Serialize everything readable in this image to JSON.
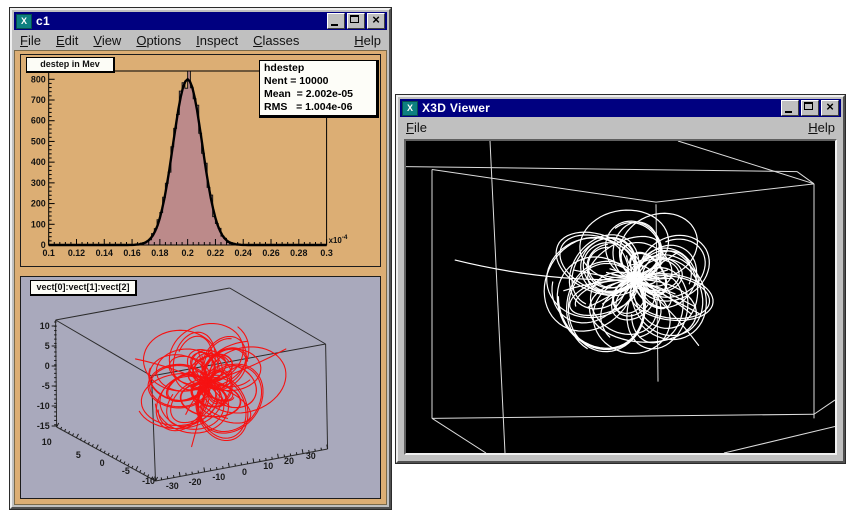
{
  "colors": {
    "titlebar_blue": "#000080",
    "window_gray": "#c0c0c0",
    "canvas_tan": "#dcae74",
    "hist_fill": "#bc8a8a",
    "hist_outline": "#151515",
    "fit_line": "#000000",
    "pad2_lavender": "#a9a9bc",
    "box_line_dark": "#2b2b2b",
    "track_red": "#f61212",
    "x3d_bg": "#000000",
    "x3d_box_line": "#dcdcdc",
    "x3d_track": "#ffffff",
    "icon_teal": "#0d8080"
  },
  "root_window": {
    "title": "c1",
    "icon_glyph": "X",
    "menus": [
      "File",
      "Edit",
      "View",
      "Options",
      "Inspect",
      "Classes"
    ],
    "help_menu": "Help",
    "pad1_title": "destep in Mev",
    "stats_lines": [
      "hdestep",
      "Nent = 10000",
      "Mean  = 2.002e-05",
      "RMS   = 1.004e-06"
    ],
    "pad2_title": "vect[0]:vect[1]:vect[2]"
  },
  "x3d_window": {
    "title": "X3D Viewer",
    "icon_glyph": "X",
    "menus": [
      "File"
    ],
    "help_menu": "Help"
  },
  "chart_data": [
    {
      "type": "histogram",
      "title": "destep in Mev",
      "histogram_name": "hdestep",
      "entries": 10000,
      "mean": "2.002e-05",
      "rms": "1.004e-06",
      "distribution": "gaussian",
      "x_axis_exponent_base": "x10",
      "x_axis_exponent_sup": "-4",
      "x_range": [
        0.1,
        0.3
      ],
      "y_range": [
        0,
        840
      ],
      "bins": 100,
      "gaussian": {
        "mean": 0.2,
        "sigma": 0.0105,
        "amplitude": 805,
        "fit_amplitude": 800
      },
      "x_tick_labels": [
        "0.1",
        "0.12",
        "0.14",
        "0.16",
        "0.18",
        "0.2",
        "0.22",
        "0.24",
        "0.26",
        "0.28",
        "0.3"
      ],
      "y_tick_labels": [
        "0",
        "100",
        "200",
        "300",
        "400",
        "500",
        "600",
        "700",
        "800"
      ],
      "grid": false,
      "legend": false
    },
    {
      "type": "scatter3d",
      "title": "vect[0]:vect[1]:vect[2]",
      "description": "red helical particle-track curves radiating from a central vertex inside a black wireframe 3D box on lavender pad",
      "x_tick_labels": [
        "10",
        "5",
        "0",
        "-5",
        "-10"
      ],
      "y_tick_labels": [
        "-30",
        "-20",
        "-10",
        "0",
        "10",
        "20",
        "30"
      ],
      "z_tick_labels": [
        "10",
        "5",
        "0",
        "-5",
        "-10",
        "-15"
      ],
      "x_range": [
        -10,
        10
      ],
      "y_range": [
        -30,
        30
      ],
      "z_range": [
        -15,
        10
      ]
    },
    {
      "type": "scatter3d",
      "title": "X3D Viewer scene",
      "description": "white helical particle tracks radiating from a central vertex inside a white wireframe perspective box on black background"
    }
  ]
}
